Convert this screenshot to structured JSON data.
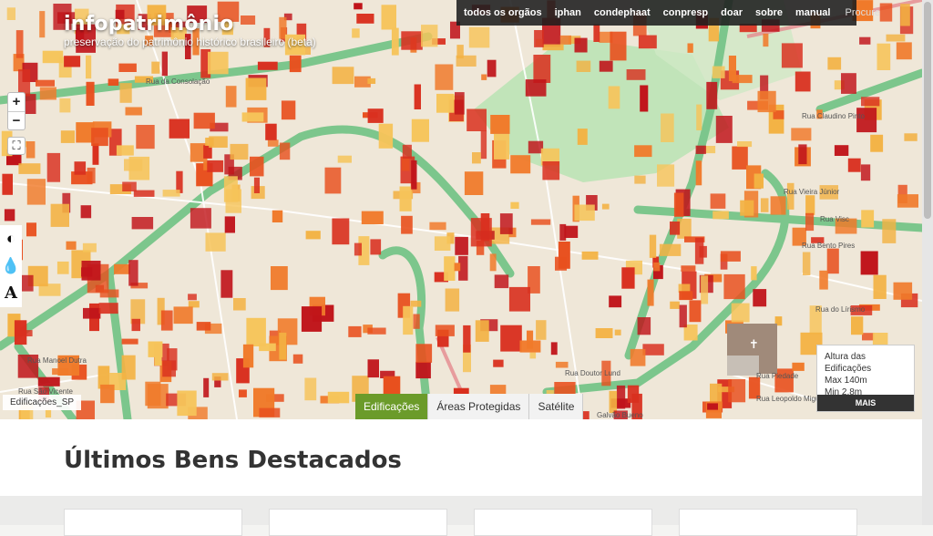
{
  "site": {
    "title": "infopatrimônio",
    "subtitle": "preservação do patrimônio histórico brasileiro (beta)"
  },
  "nav": {
    "items": [
      "todos os orgãos",
      "iphan",
      "condephaat",
      "conpresp",
      "doar",
      "sobre",
      "manual"
    ],
    "search_label": "Procure"
  },
  "map": {
    "zoom_in": "+",
    "zoom_out": "−",
    "fullscreen_icon": "⛶",
    "layer_label": "Edificações_SP",
    "tools": [
      "contrast-icon",
      "water-drop-icon",
      "font-size-icon"
    ],
    "tabs": [
      {
        "label": "Edificações",
        "active": true
      },
      {
        "label": "Áreas Protegidas",
        "active": false
      },
      {
        "label": "Satélite",
        "active": false
      }
    ],
    "legend": {
      "title": "Altura das Edificações",
      "max": "Max 140m",
      "min": "Min 2,8m",
      "more": "MAIS"
    },
    "colors": {
      "accent": "#6b9b2a",
      "building_high": "#c0141a",
      "building_mid": "#e8501e",
      "building_low": "#f3b243",
      "road": "#7cc68c"
    }
  },
  "section": {
    "title": "Últimos Bens Destacados"
  }
}
